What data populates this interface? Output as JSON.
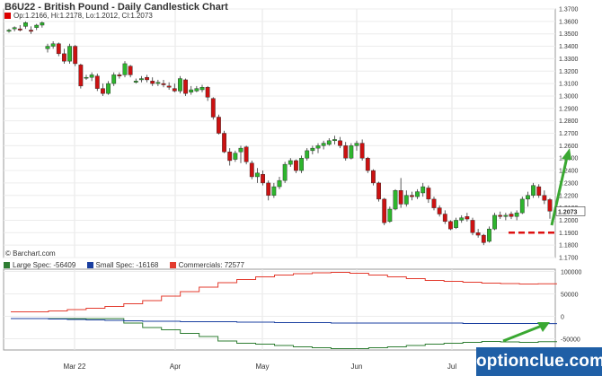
{
  "header": {
    "title": "B6U22 - British Pound - Daily Candlestick Chart",
    "ohlc": "Op:1.2166, Hi:1.2178, Lo:1.2012, Cl:1.2073",
    "copyright": "© Barchart.com",
    "last_price_label": "1.2073",
    "watermark": "optionclue.com"
  },
  "colors": {
    "up": "#2db52d",
    "down": "#cc1111",
    "large_spec": "#2e7d32",
    "small_spec": "#1a3fa0",
    "commercials": "#e33b2e",
    "annotation": "#dd1111",
    "arrow": "#3aa832",
    "watermark_bg": "#1f5fa6"
  },
  "chart_data": [
    {
      "type": "candlestick",
      "title": "B6U22 - British Pound - Daily Candlestick Chart",
      "ylim": [
        1.17,
        1.37
      ],
      "y_ticks": [
        1.17,
        1.18,
        1.19,
        1.2,
        1.21,
        1.22,
        1.23,
        1.24,
        1.25,
        1.26,
        1.27,
        1.28,
        1.29,
        1.3,
        1.31,
        1.32,
        1.33,
        1.34,
        1.35,
        1.36,
        1.37
      ],
      "x_labels": [
        "Mar 22",
        "Apr",
        "May",
        "Jun",
        "Jul"
      ],
      "candles": [
        [
          1.352,
          1.354,
          1.351,
          1.353
        ],
        [
          1.354,
          1.356,
          1.352,
          1.355
        ],
        [
          1.354,
          1.357,
          1.352,
          1.353
        ],
        [
          1.356,
          1.36,
          1.354,
          1.359
        ],
        [
          1.353,
          1.356,
          1.35,
          1.352
        ],
        [
          1.355,
          1.358,
          1.353,
          1.357
        ],
        [
          1.357,
          1.36,
          1.355,
          1.359
        ],
        [
          1.338,
          1.342,
          1.335,
          1.34
        ],
        [
          1.34,
          1.344,
          1.338,
          1.342
        ],
        [
          1.342,
          1.343,
          1.332,
          1.334
        ],
        [
          1.334,
          1.338,
          1.326,
          1.328
        ],
        [
          1.328,
          1.342,
          1.326,
          1.34
        ],
        [
          1.34,
          1.341,
          1.324,
          1.326
        ],
        [
          1.325,
          1.326,
          1.306,
          1.308
        ],
        [
          1.315,
          1.317,
          1.313,
          1.315
        ],
        [
          1.315,
          1.319,
          1.312,
          1.317
        ],
        [
          1.316,
          1.318,
          1.304,
          1.306
        ],
        [
          1.306,
          1.31,
          1.3,
          1.302
        ],
        [
          1.302,
          1.312,
          1.301,
          1.31
        ],
        [
          1.31,
          1.319,
          1.308,
          1.317
        ],
        [
          1.317,
          1.319,
          1.314,
          1.316
        ],
        [
          1.317,
          1.328,
          1.315,
          1.326
        ],
        [
          1.324,
          1.325,
          1.315,
          1.317
        ],
        [
          1.311,
          1.314,
          1.31,
          1.312
        ],
        [
          1.313,
          1.316,
          1.311,
          1.314
        ],
        [
          1.315,
          1.317,
          1.311,
          1.313
        ],
        [
          1.312,
          1.315,
          1.308,
          1.31
        ],
        [
          1.31,
          1.313,
          1.308,
          1.311
        ],
        [
          1.31,
          1.313,
          1.307,
          1.309
        ],
        [
          1.308,
          1.311,
          1.305,
          1.307
        ],
        [
          1.306,
          1.31,
          1.303,
          1.304
        ],
        [
          1.304,
          1.316,
          1.302,
          1.314
        ],
        [
          1.313,
          1.314,
          1.3,
          1.302
        ],
        [
          1.303,
          1.308,
          1.301,
          1.305
        ],
        [
          1.304,
          1.308,
          1.303,
          1.306
        ],
        [
          1.305,
          1.309,
          1.303,
          1.307
        ],
        [
          1.307,
          1.308,
          1.296,
          1.299
        ],
        [
          1.298,
          1.299,
          1.281,
          1.283
        ],
        [
          1.283,
          1.285,
          1.269,
          1.27
        ],
        [
          1.27,
          1.272,
          1.254,
          1.255
        ],
        [
          1.255,
          1.258,
          1.244,
          1.248
        ],
        [
          1.249,
          1.256,
          1.247,
          1.254
        ],
        [
          1.255,
          1.26,
          1.246,
          1.258
        ],
        [
          1.259,
          1.26,
          1.245,
          1.247
        ],
        [
          1.246,
          1.248,
          1.233,
          1.235
        ],
        [
          1.235,
          1.242,
          1.23,
          1.238
        ],
        [
          1.237,
          1.24,
          1.228,
          1.23
        ],
        [
          1.23,
          1.232,
          1.216,
          1.22
        ],
        [
          1.22,
          1.23,
          1.218,
          1.227
        ],
        [
          1.227,
          1.235,
          1.225,
          1.232
        ],
        [
          1.232,
          1.247,
          1.23,
          1.245
        ],
        [
          1.245,
          1.25,
          1.243,
          1.248
        ],
        [
          1.248,
          1.249,
          1.238,
          1.24
        ],
        [
          1.24,
          1.252,
          1.238,
          1.25
        ],
        [
          1.25,
          1.258,
          1.248,
          1.256
        ],
        [
          1.256,
          1.26,
          1.253,
          1.258
        ],
        [
          1.258,
          1.262,
          1.254,
          1.26
        ],
        [
          1.26,
          1.264,
          1.257,
          1.262
        ],
        [
          1.261,
          1.266,
          1.26,
          1.264
        ],
        [
          1.264,
          1.268,
          1.261,
          1.265
        ],
        [
          1.264,
          1.267,
          1.258,
          1.26
        ],
        [
          1.26,
          1.263,
          1.248,
          1.25
        ],
        [
          1.25,
          1.262,
          1.249,
          1.26
        ],
        [
          1.26,
          1.264,
          1.256,
          1.262
        ],
        [
          1.262,
          1.265,
          1.248,
          1.25
        ],
        [
          1.25,
          1.251,
          1.238,
          1.24
        ],
        [
          1.24,
          1.241,
          1.228,
          1.23
        ],
        [
          1.23,
          1.231,
          1.215,
          1.217
        ],
        [
          1.217,
          1.218,
          1.196,
          1.198
        ],
        [
          1.199,
          1.211,
          1.198,
          1.209
        ],
        [
          1.209,
          1.225,
          1.208,
          1.224
        ],
        [
          1.224,
          1.234,
          1.21,
          1.213
        ],
        [
          1.213,
          1.224,
          1.211,
          1.22
        ],
        [
          1.22,
          1.223,
          1.216,
          1.219
        ],
        [
          1.219,
          1.225,
          1.217,
          1.223
        ],
        [
          1.222,
          1.23,
          1.219,
          1.227
        ],
        [
          1.226,
          1.228,
          1.214,
          1.217
        ],
        [
          1.217,
          1.219,
          1.208,
          1.21
        ],
        [
          1.21,
          1.212,
          1.203,
          1.205
        ],
        [
          1.205,
          1.208,
          1.197,
          1.199
        ],
        [
          1.199,
          1.2,
          1.192,
          1.193
        ],
        [
          1.194,
          1.202,
          1.193,
          1.2
        ],
        [
          1.2,
          1.204,
          1.198,
          1.202
        ],
        [
          1.203,
          1.206,
          1.199,
          1.201
        ],
        [
          1.2,
          1.202,
          1.188,
          1.19
        ],
        [
          1.19,
          1.193,
          1.186,
          1.188
        ],
        [
          1.188,
          1.189,
          1.18,
          1.182
        ],
        [
          1.183,
          1.195,
          1.182,
          1.193
        ],
        [
          1.193,
          1.206,
          1.192,
          1.204
        ],
        [
          1.204,
          1.207,
          1.201,
          1.203
        ],
        [
          1.203,
          1.206,
          1.2,
          1.204
        ],
        [
          1.205,
          1.207,
          1.201,
          1.203
        ],
        [
          1.203,
          1.208,
          1.2,
          1.206
        ],
        [
          1.206,
          1.219,
          1.205,
          1.217
        ],
        [
          1.217,
          1.223,
          1.211,
          1.22
        ],
        [
          1.22,
          1.23,
          1.218,
          1.228
        ],
        [
          1.227,
          1.229,
          1.218,
          1.22
        ],
        [
          1.22,
          1.224,
          1.213,
          1.216
        ],
        [
          1.2166,
          1.2178,
          1.2012,
          1.2073
        ]
      ],
      "annotations": {
        "support_level": 1.19,
        "arrow_from": 1.196,
        "arrow_to": 1.258
      }
    },
    {
      "type": "line",
      "title": "COT",
      "ylim": [
        -75000,
        105000
      ],
      "y_ticks": [
        100000,
        50000,
        0,
        -50000
      ],
      "series": [
        {
          "name": "Large Spec: -56409",
          "values": [
            -5000,
            -5000,
            -5000,
            -5000,
            -5000,
            -5000,
            -15000,
            -25000,
            -30000,
            -38000,
            -45000,
            -55000,
            -60000,
            -62000,
            -65000,
            -68000,
            -70000,
            -72000,
            -72000,
            -70000,
            -68000,
            -65000,
            -62000,
            -60000,
            -58000,
            -56000,
            -57000,
            -58000,
            -56409,
            -56409
          ]
        },
        {
          "name": "Small Spec: -16168",
          "values": [
            -5000,
            -5000,
            -6000,
            -7000,
            -8000,
            -9000,
            -10000,
            -11000,
            -11000,
            -12000,
            -12000,
            -12000,
            -13000,
            -13000,
            -14000,
            -14000,
            -14000,
            -15000,
            -15000,
            -15000,
            -15000,
            -15000,
            -15000,
            -15000,
            -16000,
            -16000,
            -16000,
            -16000,
            -16168,
            -16168
          ]
        },
        {
          "name": "Commercials: 72577",
          "values": [
            10000,
            10000,
            12000,
            15000,
            18000,
            22000,
            28000,
            35000,
            45000,
            55000,
            65000,
            75000,
            82000,
            88000,
            92000,
            95000,
            97000,
            98000,
            96000,
            92000,
            88000,
            84000,
            80000,
            78000,
            76000,
            74000,
            73000,
            72000,
            72577,
            72577
          ]
        }
      ],
      "x_labels": [
        "Mar 22",
        "Apr",
        "May",
        "Jun",
        "Jul"
      ]
    }
  ]
}
